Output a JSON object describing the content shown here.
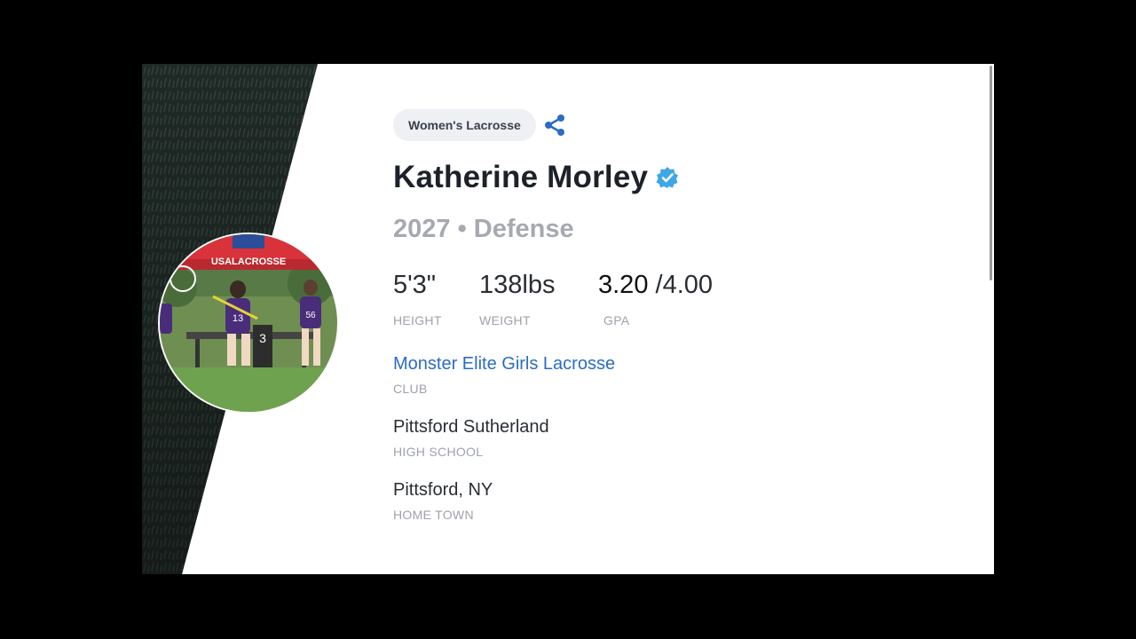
{
  "profile": {
    "sport": "Women's Lacrosse",
    "name": "Katherine Morley",
    "class_year": "2027",
    "separator": "•",
    "position": "Defense",
    "stats": {
      "height_value": "5'3\"",
      "height_label": "HEIGHT",
      "weight_value": "138lbs",
      "weight_label": "WEIGHT",
      "gpa_value": "3.20",
      "gpa_scale": "/4.00",
      "gpa_label": "GPA"
    },
    "club": {
      "value": "Monster Elite Girls Lacrosse",
      "label": "CLUB"
    },
    "high_school": {
      "value": "Pittsford Sutherland",
      "label": "HIGH SCHOOL"
    },
    "home_town": {
      "value": "Pittsford, NY",
      "label": "HOME TOWN"
    }
  },
  "avatar_photo": {
    "banner_text": "USALACROSSE",
    "jersey_numbers": [
      "13",
      "56",
      "3"
    ]
  },
  "icons": {
    "share": "share-icon",
    "verified": "verified-badge-icon"
  },
  "colors": {
    "link": "#2b6cc4",
    "verified": "#3ea7e6",
    "pill_bg": "#eef0f3",
    "dark_panel": "#1f2a26"
  }
}
